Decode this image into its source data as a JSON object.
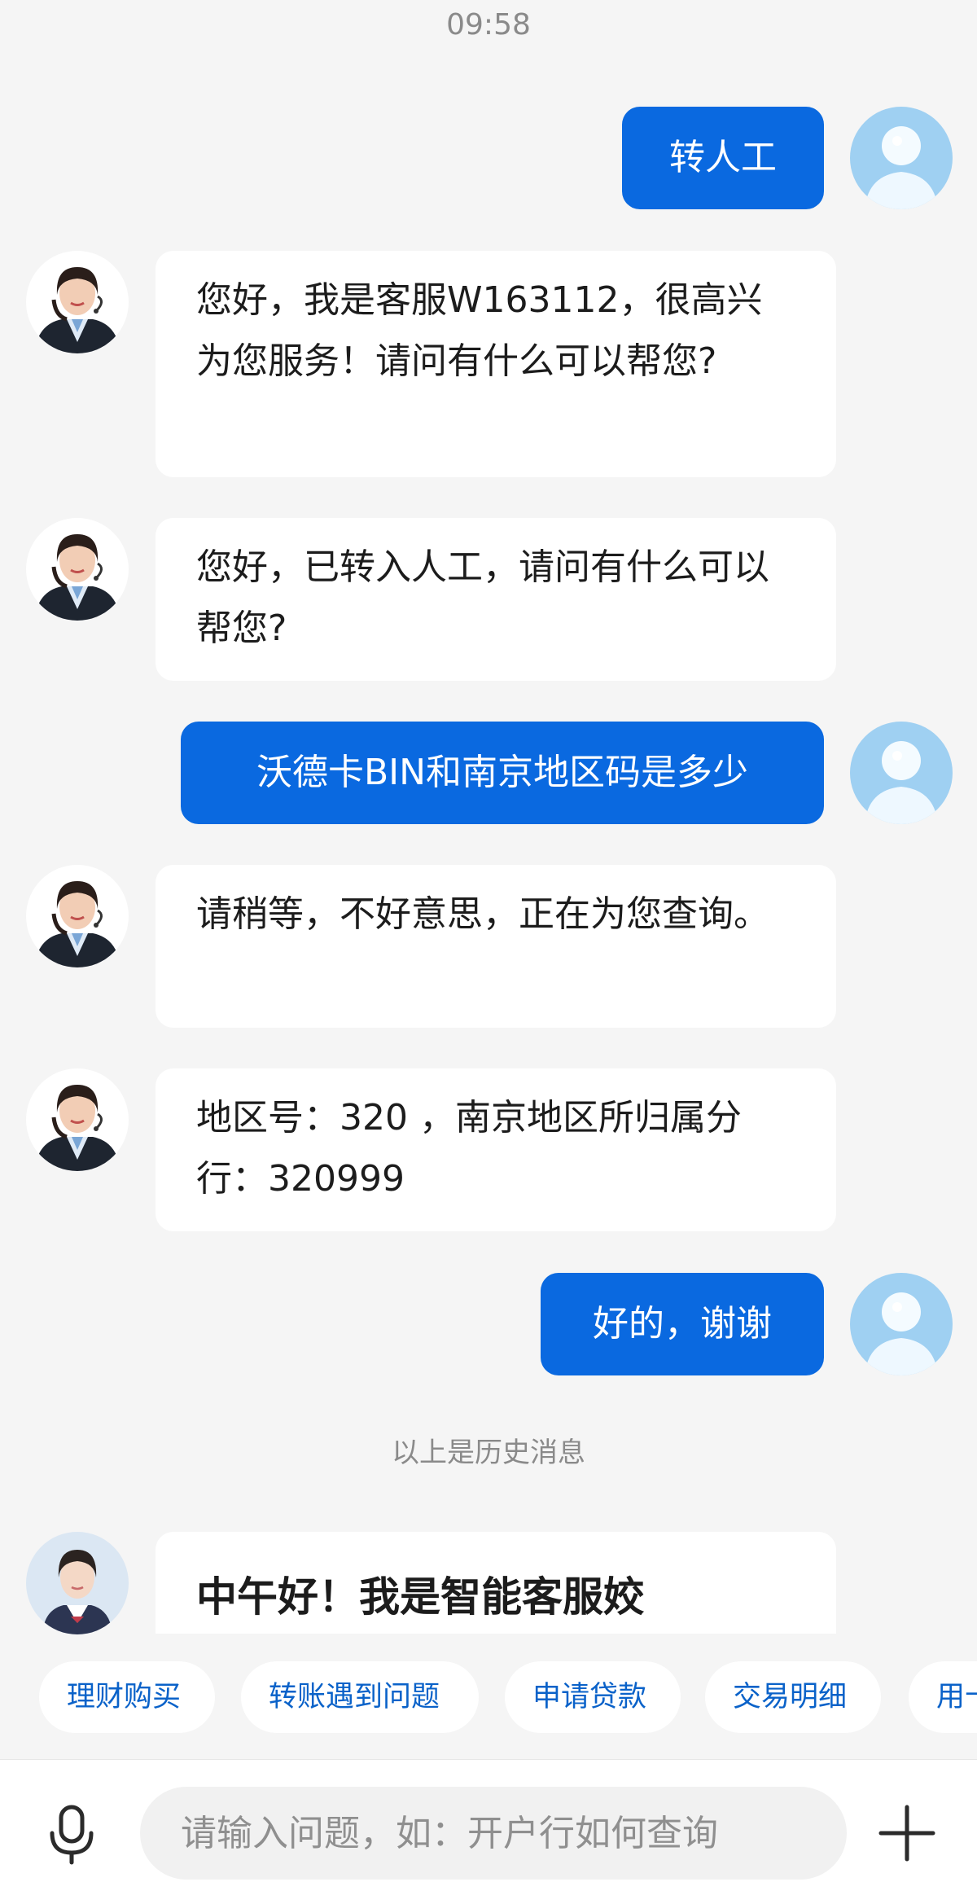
{
  "status": {
    "time": "09:58"
  },
  "messages": [
    {
      "role": "user",
      "text": "转人工"
    },
    {
      "role": "agent",
      "text": "您好，我是客服W163112，很高兴为您服务！请问有什么可以帮您?"
    },
    {
      "role": "agent",
      "text": "您好，已转入人工，请问有什么可以帮您?"
    },
    {
      "role": "user",
      "text": "沃德卡BIN和南京地区码是多少"
    },
    {
      "role": "agent",
      "text": "请稍等，不好意思，正在为您查询。"
    },
    {
      "role": "agent",
      "text": "地区号：320 ，南京地区所归属分行：320999"
    },
    {
      "role": "user",
      "text": "好的，谢谢"
    }
  ],
  "history_divider": "以上是历史消息",
  "bot_greeting": "中午好！我是智能客服姣",
  "quick_chips": [
    "理财购买",
    "转账遇到问题",
    "申请贷款",
    "交易明细",
    "用卡"
  ],
  "input": {
    "placeholder": "请输入问题，如：开户行如何查询",
    "value": ""
  },
  "colors": {
    "user_bubble": "#0a69e0",
    "chip_text": "#0a62c9",
    "background": "#f5f5f5"
  },
  "icons": {
    "voice": "microphone-icon",
    "more": "plus-icon"
  }
}
